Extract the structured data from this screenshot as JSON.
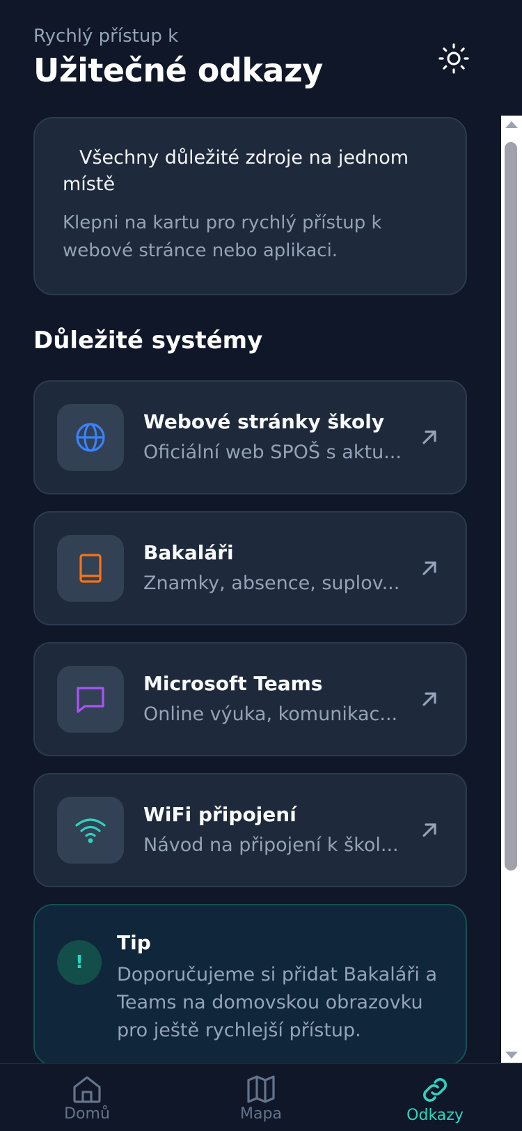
{
  "header": {
    "subtitle": "Rychlý přístup k",
    "title": "Užitečné odkazy",
    "theme_toggle_icon": "sun-icon"
  },
  "intro": {
    "title": "Všechny důležité zdroje na jednom místě",
    "text": "Klepni na kartu pro rychlý přístup k webové stránce nebo aplikaci."
  },
  "section_title": "Důležité systémy",
  "links": [
    {
      "title": "Webové stránky školy",
      "desc": "Oficiální web SPOŠ s aktu...",
      "icon": "globe-icon",
      "color": "#3b82f6"
    },
    {
      "title": "Bakaláři",
      "desc": "Znamky, absence, suplov...",
      "icon": "book-icon",
      "color": "#f97316"
    },
    {
      "title": "Microsoft Teams",
      "desc": "Online výuka, komunikac...",
      "icon": "message-icon",
      "color": "#a855f7"
    },
    {
      "title": "WiFi připojení",
      "desc": "Návod na připojení k škol...",
      "icon": "wifi-icon",
      "color": "#2dd4bf"
    }
  ],
  "tip": {
    "badge": "!",
    "title": "Tip",
    "text": "Doporučujeme si přidat Bakaláři a Teams na domovskou obrazovku pro ještě rychlejší přístup."
  },
  "nav": [
    {
      "label": "Domů",
      "icon": "home-icon",
      "active": false
    },
    {
      "label": "Mapa",
      "icon": "map-icon",
      "active": false
    },
    {
      "label": "Odkazy",
      "icon": "link-icon",
      "active": true
    }
  ],
  "colors": {
    "background": "#0f1729",
    "card": "#1e293b",
    "accent": "#2dd4bf"
  }
}
